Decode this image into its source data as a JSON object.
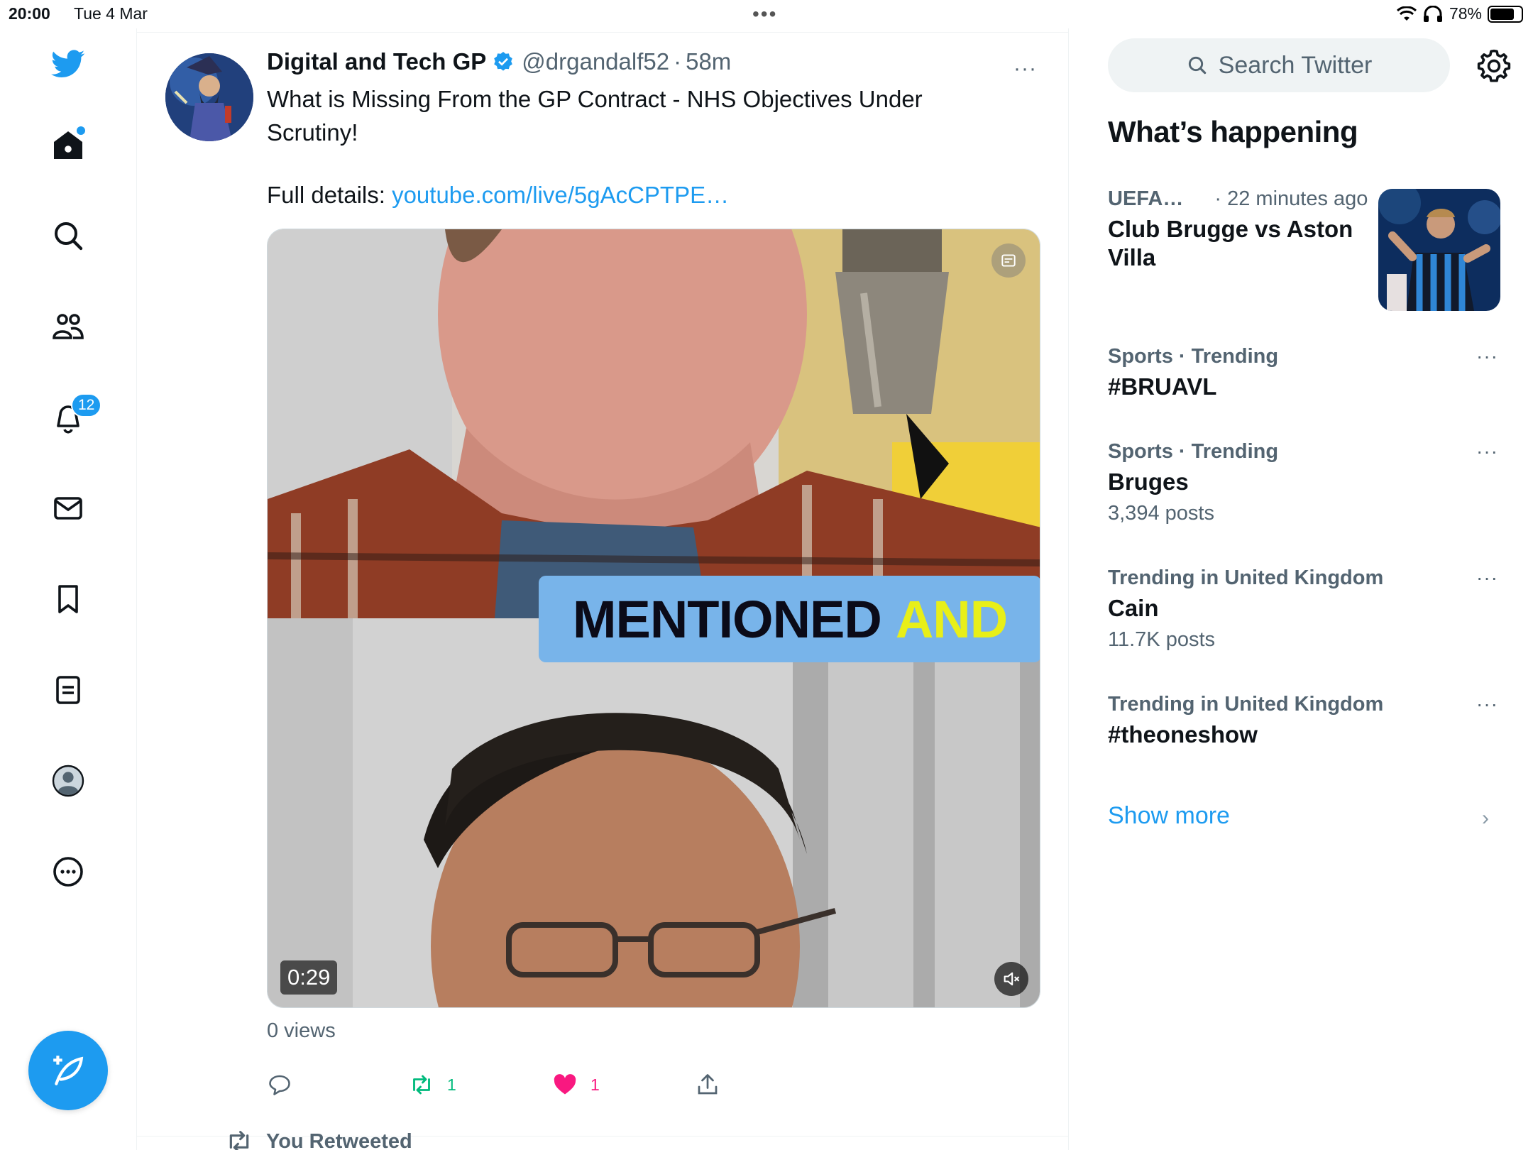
{
  "status_bar": {
    "time": "20:00",
    "date": "Tue 4 Mar",
    "battery_text": "78%",
    "battery_level": 0.78
  },
  "nav": {
    "items": [
      {
        "name": "home",
        "icon": "home-icon",
        "has_dot": true
      },
      {
        "name": "explore",
        "icon": "search-icon"
      },
      {
        "name": "communities",
        "icon": "people-icon"
      },
      {
        "name": "notifications",
        "icon": "bell-icon",
        "badge": "12"
      },
      {
        "name": "messages",
        "icon": "envelope-icon"
      },
      {
        "name": "bookmarks",
        "icon": "bookmark-icon"
      },
      {
        "name": "lists",
        "icon": "list-icon"
      },
      {
        "name": "profile",
        "icon": "profile-avatar-icon"
      },
      {
        "name": "more",
        "icon": "more-circle-icon"
      }
    ],
    "compose_icon": "compose-feather-icon"
  },
  "tweet": {
    "author_name": "Digital and Tech GP",
    "handle": "@drgandalf52",
    "separator": "·",
    "time_ago": "58m",
    "text": "What is Missing From the GP Contract - NHS Objectives Under Scrutiny!",
    "details_label": "Full details: ",
    "link_text": "youtube.com/live/5gAcCPTPE…",
    "video": {
      "caption_word1": "MENTIONED",
      "caption_word2": "AND",
      "duration": "0:29"
    },
    "views": "0 views",
    "retweet_count": "1",
    "like_count": "1",
    "colors": {
      "retweet": "#00ba7c",
      "like": "#f91880",
      "link": "#1d9bf0"
    }
  },
  "next_item": {
    "label": "You Retweeted"
  },
  "sidebar": {
    "search_placeholder": "Search Twitter",
    "section_title": "What’s happening",
    "featured": {
      "category": "UEFA…",
      "time": "· 22 minutes ago",
      "title": "Club Brugge vs Aston Villa"
    },
    "trends": [
      {
        "meta": "Sports · Trending",
        "title": "#BRUAVL",
        "count": ""
      },
      {
        "meta": "Sports · Trending",
        "title": "Bruges",
        "count": "3,394 posts"
      },
      {
        "meta": "Trending in United Kingdom",
        "title": "Cain",
        "count": "11.7K posts"
      },
      {
        "meta": "Trending in United Kingdom",
        "title": "#theoneshow",
        "count": ""
      }
    ],
    "show_more": "Show more"
  }
}
